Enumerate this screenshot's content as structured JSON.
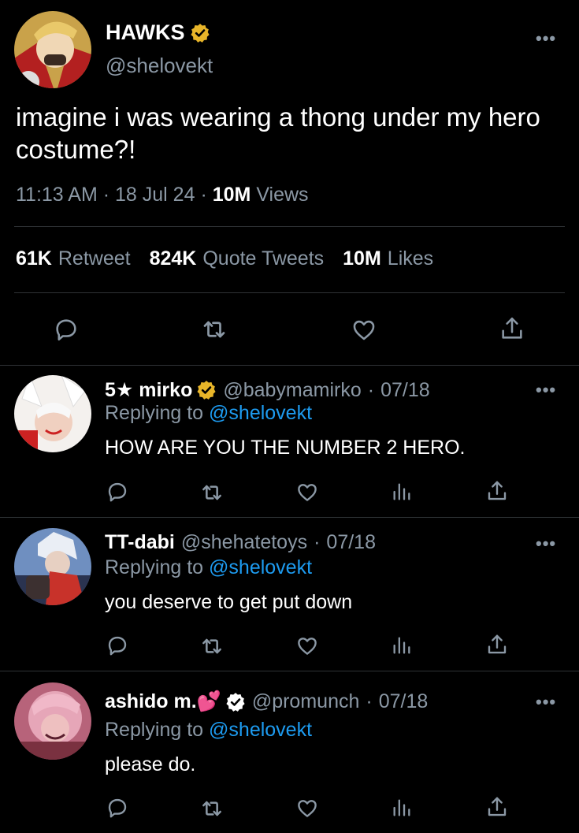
{
  "main_tweet": {
    "display_name": "HAWKS",
    "handle": "@shelovekt",
    "text": "imagine i was wearing a thong under my hero costume?!",
    "time": "11:13 AM",
    "date": "18 Jul 24",
    "views_count": "10M",
    "views_label": "Views",
    "retweets_count": "61K",
    "retweets_label": "Retweet",
    "quotes_count": "824K",
    "quotes_label": "Quote Tweets",
    "likes_count": "10M",
    "likes_label": "Likes"
  },
  "replies": [
    {
      "display_name": "5★ mirko",
      "handle": "@babymamirko",
      "date": "07/18",
      "replying_to_label": "Replying to",
      "replying_to": "@shelovekt",
      "text": "HOW ARE YOU THE NUMBER 2 HERO."
    },
    {
      "display_name": "TT-dabi",
      "handle": "@shehatetoys",
      "date": "07/18",
      "replying_to_label": "Replying to",
      "replying_to": "@shelovekt",
      "text": "you deserve to get put down"
    },
    {
      "display_name": "ashido m.💕",
      "handle": "@promunch",
      "date": "07/18",
      "replying_to_label": "Replying to",
      "replying_to": "@shelovekt",
      "text": "please do."
    }
  ],
  "ui": {
    "more_label": "•••",
    "dot": "·"
  },
  "colors": {
    "background": "#000000",
    "text_primary": "#ffffff",
    "text_secondary": "#8b98a5",
    "link": "#1d9bf0",
    "verified_gold": "#e8b529",
    "divider": "#2f3336"
  }
}
